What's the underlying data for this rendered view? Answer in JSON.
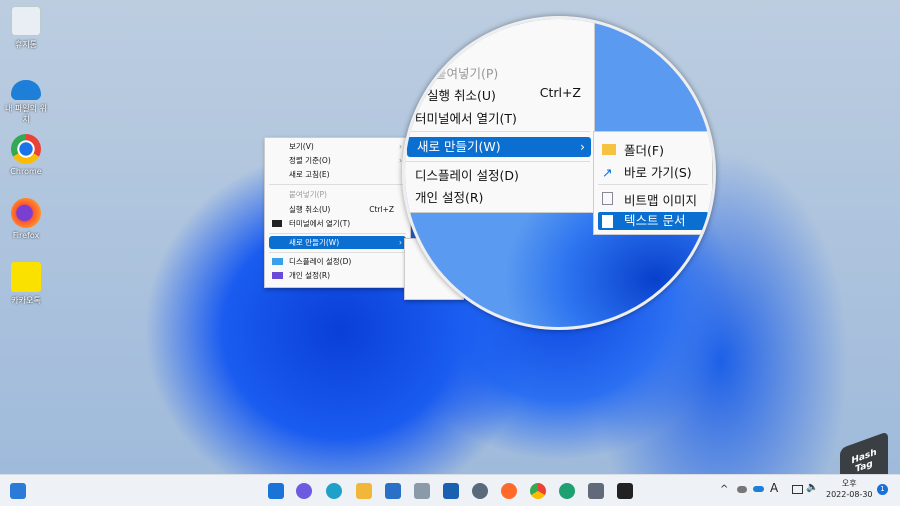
{
  "desktop_icons": [
    {
      "label": "휴지통",
      "icon": "recycle-bin-icon"
    },
    {
      "label": "내 파일의 위치",
      "icon": "onedrive-icon"
    },
    {
      "label": "Chrome",
      "icon": "chrome-icon"
    },
    {
      "label": "Firefox",
      "icon": "firefox-icon"
    },
    {
      "label": "카카오톡",
      "icon": "kakaotalk-icon"
    }
  ],
  "context_menu": {
    "items": [
      {
        "label": "보기(V)"
      },
      {
        "label": "정렬 기준(O)"
      },
      {
        "label": "새로 고침(E)"
      },
      {
        "label": "붙여넣기(P)"
      },
      {
        "label": "실행 취소(U)",
        "shortcut": "Ctrl+Z"
      },
      {
        "label": "터미널에서 열기(T)"
      },
      {
        "label": "새로 만들기(W)"
      },
      {
        "label": "디스플레이 설정(D)"
      },
      {
        "label": "개인 설정(R)"
      }
    ]
  },
  "submenu": {
    "items": [
      {
        "label": "폴더(F)"
      },
      {
        "label": "바로 가기(S)"
      },
      {
        "label": "비트맵 이미지"
      },
      {
        "label": "텍스트 문서"
      }
    ]
  },
  "tray": {
    "ime": "A",
    "time": "오후",
    "date": "2022-08-30",
    "notif": "1"
  },
  "watermark": "Hash Tag",
  "colors": {
    "accent": "#0a6fd0"
  }
}
